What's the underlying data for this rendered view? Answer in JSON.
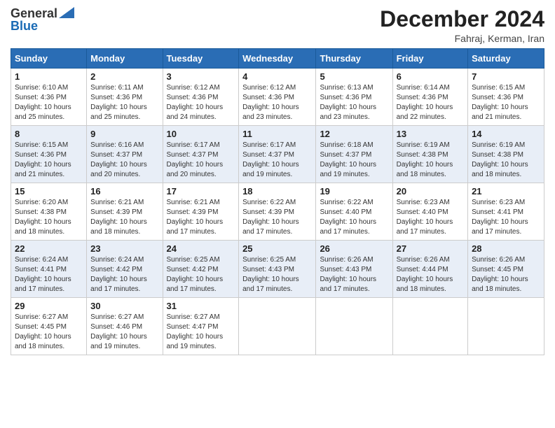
{
  "header": {
    "logo_line1": "General",
    "logo_line2": "Blue",
    "main_title": "December 2024",
    "subtitle": "Fahraj, Kerman, Iran"
  },
  "calendar": {
    "days_of_week": [
      "Sunday",
      "Monday",
      "Tuesday",
      "Wednesday",
      "Thursday",
      "Friday",
      "Saturday"
    ],
    "weeks": [
      [
        null,
        {
          "day": "2",
          "sunrise": "6:11 AM",
          "sunset": "4:36 PM",
          "daylight": "10 hours and 25 minutes."
        },
        {
          "day": "3",
          "sunrise": "6:12 AM",
          "sunset": "4:36 PM",
          "daylight": "10 hours and 24 minutes."
        },
        {
          "day": "4",
          "sunrise": "6:12 AM",
          "sunset": "4:36 PM",
          "daylight": "10 hours and 23 minutes."
        },
        {
          "day": "5",
          "sunrise": "6:13 AM",
          "sunset": "4:36 PM",
          "daylight": "10 hours and 23 minutes."
        },
        {
          "day": "6",
          "sunrise": "6:14 AM",
          "sunset": "4:36 PM",
          "daylight": "10 hours and 22 minutes."
        },
        {
          "day": "7",
          "sunrise": "6:15 AM",
          "sunset": "4:36 PM",
          "daylight": "10 hours and 21 minutes."
        }
      ],
      [
        {
          "day": "1",
          "sunrise": "6:10 AM",
          "sunset": "4:36 PM",
          "daylight": "10 hours and 25 minutes."
        },
        null,
        null,
        null,
        null,
        null,
        null
      ],
      [
        {
          "day": "8",
          "sunrise": "6:15 AM",
          "sunset": "4:36 PM",
          "daylight": "10 hours and 21 minutes."
        },
        {
          "day": "9",
          "sunrise": "6:16 AM",
          "sunset": "4:37 PM",
          "daylight": "10 hours and 20 minutes."
        },
        {
          "day": "10",
          "sunrise": "6:17 AM",
          "sunset": "4:37 PM",
          "daylight": "10 hours and 20 minutes."
        },
        {
          "day": "11",
          "sunrise": "6:17 AM",
          "sunset": "4:37 PM",
          "daylight": "10 hours and 19 minutes."
        },
        {
          "day": "12",
          "sunrise": "6:18 AM",
          "sunset": "4:37 PM",
          "daylight": "10 hours and 19 minutes."
        },
        {
          "day": "13",
          "sunrise": "6:19 AM",
          "sunset": "4:38 PM",
          "daylight": "10 hours and 18 minutes."
        },
        {
          "day": "14",
          "sunrise": "6:19 AM",
          "sunset": "4:38 PM",
          "daylight": "10 hours and 18 minutes."
        }
      ],
      [
        {
          "day": "15",
          "sunrise": "6:20 AM",
          "sunset": "4:38 PM",
          "daylight": "10 hours and 18 minutes."
        },
        {
          "day": "16",
          "sunrise": "6:21 AM",
          "sunset": "4:39 PM",
          "daylight": "10 hours and 18 minutes."
        },
        {
          "day": "17",
          "sunrise": "6:21 AM",
          "sunset": "4:39 PM",
          "daylight": "10 hours and 17 minutes."
        },
        {
          "day": "18",
          "sunrise": "6:22 AM",
          "sunset": "4:39 PM",
          "daylight": "10 hours and 17 minutes."
        },
        {
          "day": "19",
          "sunrise": "6:22 AM",
          "sunset": "4:40 PM",
          "daylight": "10 hours and 17 minutes."
        },
        {
          "day": "20",
          "sunrise": "6:23 AM",
          "sunset": "4:40 PM",
          "daylight": "10 hours and 17 minutes."
        },
        {
          "day": "21",
          "sunrise": "6:23 AM",
          "sunset": "4:41 PM",
          "daylight": "10 hours and 17 minutes."
        }
      ],
      [
        {
          "day": "22",
          "sunrise": "6:24 AM",
          "sunset": "4:41 PM",
          "daylight": "10 hours and 17 minutes."
        },
        {
          "day": "23",
          "sunrise": "6:24 AM",
          "sunset": "4:42 PM",
          "daylight": "10 hours and 17 minutes."
        },
        {
          "day": "24",
          "sunrise": "6:25 AM",
          "sunset": "4:42 PM",
          "daylight": "10 hours and 17 minutes."
        },
        {
          "day": "25",
          "sunrise": "6:25 AM",
          "sunset": "4:43 PM",
          "daylight": "10 hours and 17 minutes."
        },
        {
          "day": "26",
          "sunrise": "6:26 AM",
          "sunset": "4:43 PM",
          "daylight": "10 hours and 17 minutes."
        },
        {
          "day": "27",
          "sunrise": "6:26 AM",
          "sunset": "4:44 PM",
          "daylight": "10 hours and 18 minutes."
        },
        {
          "day": "28",
          "sunrise": "6:26 AM",
          "sunset": "4:45 PM",
          "daylight": "10 hours and 18 minutes."
        }
      ],
      [
        {
          "day": "29",
          "sunrise": "6:27 AM",
          "sunset": "4:45 PM",
          "daylight": "10 hours and 18 minutes."
        },
        {
          "day": "30",
          "sunrise": "6:27 AM",
          "sunset": "4:46 PM",
          "daylight": "10 hours and 19 minutes."
        },
        {
          "day": "31",
          "sunrise": "6:27 AM",
          "sunset": "4:47 PM",
          "daylight": "10 hours and 19 minutes."
        },
        null,
        null,
        null,
        null
      ]
    ]
  }
}
